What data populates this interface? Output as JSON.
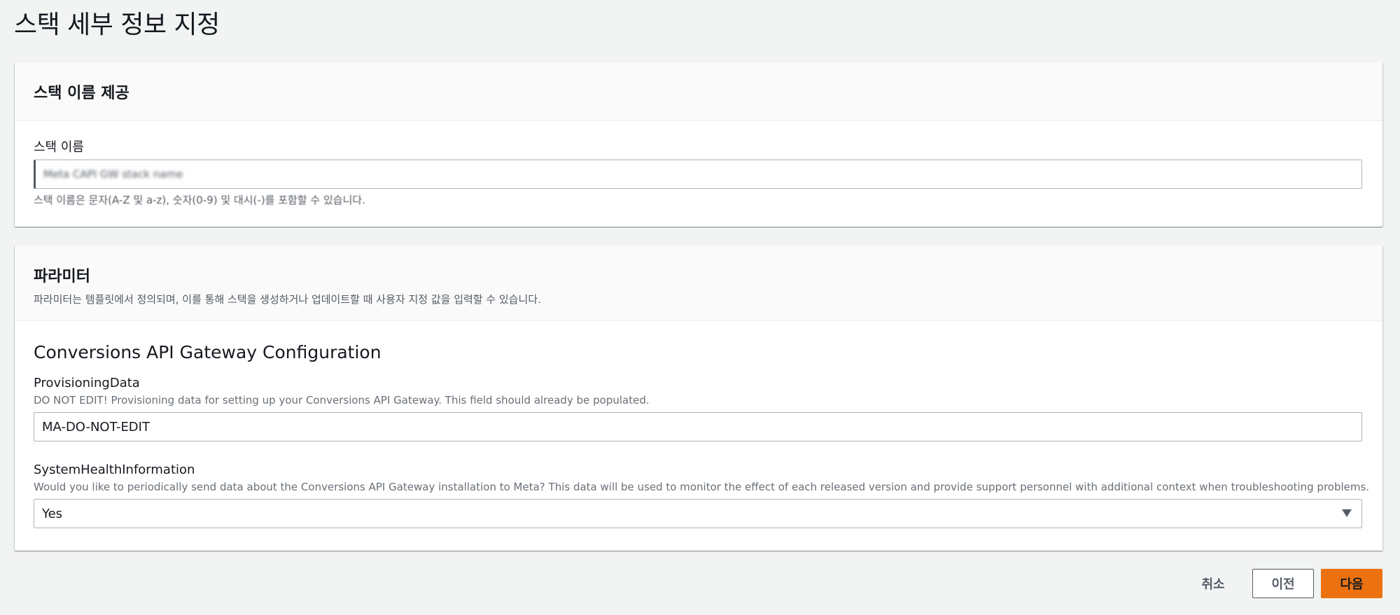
{
  "page": {
    "title": "스택 세부 정보 지정"
  },
  "stack_name_panel": {
    "header": "스택 이름 제공",
    "field_label": "스택 이름",
    "field_value": "Meta CAPI GW stack name",
    "field_hint": "스택 이름은 문자(A-Z 및 a-z), 숫자(0-9) 및 대시(-)를 포함할 수 있습니다."
  },
  "parameters_panel": {
    "header": "파라미터",
    "description": "파라미터는 템플릿에서 정의되며, 이를 통해 스택을 생성하거나 업데이트할 때 사용자 지정 값을 입력할 수 있습니다.",
    "section_title": "Conversions API Gateway Configuration",
    "provisioning": {
      "label": "ProvisioningData",
      "description": "DO NOT EDIT! Provisioning data for setting up your Conversions API Gateway. This field should already be populated.",
      "value": "MA-DO-NOT-EDIT"
    },
    "system_health": {
      "label": "SystemHealthInformation",
      "description": "Would you like to periodically send data about the Conversions API Gateway installation to Meta? This data will be used to monitor the effect of each released version and provide support personnel with additional context when troubleshooting problems.",
      "selected": "Yes",
      "caret_icon": "caret-down-icon"
    }
  },
  "footer": {
    "cancel_label": "취소",
    "previous_label": "이전",
    "next_label": "다음"
  },
  "colors": {
    "primary_button": "#ec7211",
    "page_background": "#f2f3f3",
    "panel_header_background": "#fafafa"
  }
}
